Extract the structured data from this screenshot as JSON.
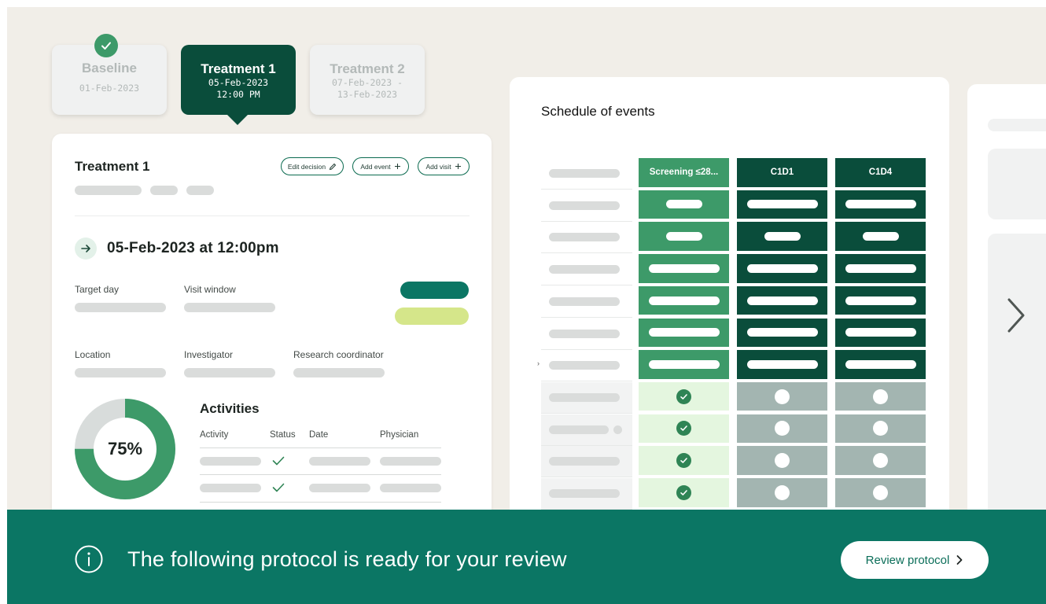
{
  "timeline": {
    "tabs": [
      {
        "title": "Baseline",
        "date": "01-Feb-2023",
        "time": "",
        "state": "completed"
      },
      {
        "title": "Treatment 1",
        "date": "05-Feb-2023",
        "time": "12:00 PM",
        "state": "active"
      },
      {
        "title": "Treatment 2",
        "date": "07-Feb-2023 -",
        "time": "13-Feb-2023",
        "state": "upcoming"
      }
    ]
  },
  "visit": {
    "title": "Treatment 1",
    "buttons": {
      "edit": "Edit decision",
      "add_event": "Add event",
      "add_visit": "Add visit"
    },
    "datetime": "05-Feb-2023 at 12:00pm",
    "fields": {
      "target_day": "Target day",
      "visit_window": "Visit window",
      "location": "Location",
      "investigator": "Investigator",
      "research_coordinator": "Research coordinator"
    },
    "status_colors": {
      "primary": "#0b7664",
      "secondary": "#d5e68a"
    },
    "progress": {
      "label": "75%",
      "value": 0.75,
      "color": "#3d9a69"
    },
    "activities": {
      "title": "Activities",
      "columns": [
        "Activity",
        "Status",
        "Date",
        "Physician"
      ],
      "row_status": [
        "complete",
        "complete"
      ]
    }
  },
  "schedule": {
    "title": "Schedule of events",
    "columns": [
      "Screening ≤28...",
      "C1D1",
      "C1D4"
    ],
    "column_colors": [
      "#3d9a69",
      "#0a4d3b",
      "#0a4d3b"
    ]
  },
  "banner": {
    "message": "The following protocol is ready for your review",
    "action": "Review protocol",
    "color": "#0b7664"
  }
}
